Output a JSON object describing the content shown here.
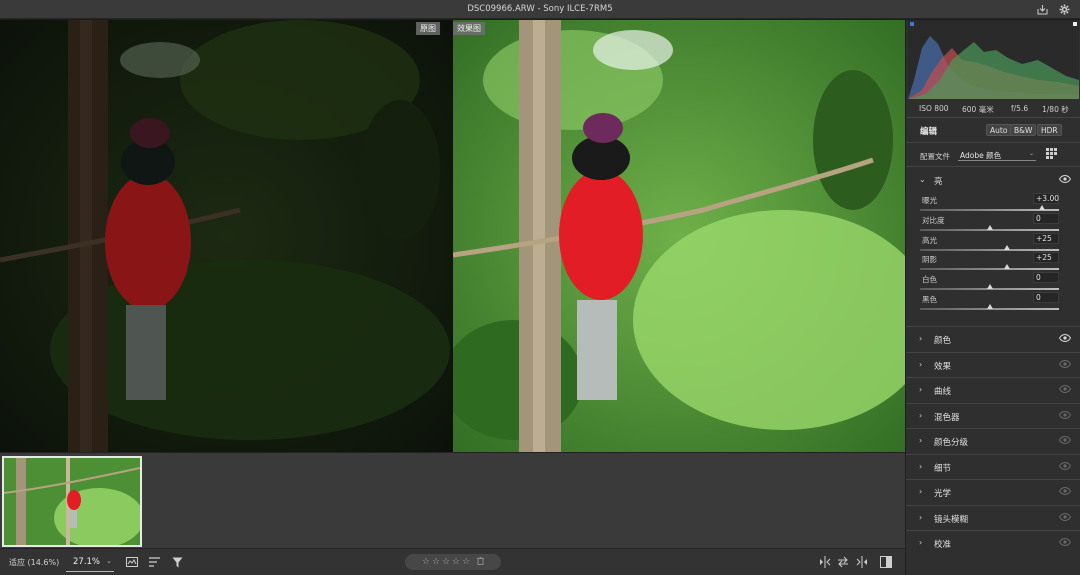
{
  "window": {
    "title": "DSC09966.ARW - Sony ILCE-7RM5"
  },
  "viewer": {
    "before_label": "原图",
    "after_label": "效果图"
  },
  "bottombar": {
    "fit_label": "适应 (14.6%)",
    "zoom_value": "27.1%",
    "stars": [
      "☆",
      "☆",
      "☆",
      "☆",
      "☆"
    ],
    "icons": [
      "compare-icon",
      "sort-icon",
      "filter-icon",
      "swap-left-icon",
      "swap-icon",
      "swap-right-icon",
      "split-view-icon"
    ]
  },
  "panel": {
    "histogram_colors": {
      "red": "#c0504d",
      "green": "#4c9a5a",
      "blue": "#4a6fb0"
    },
    "exif": {
      "iso": "ISO 800",
      "focal": "600 毫米",
      "aperture": "f/5.6",
      "shutter": "1/80 秒"
    },
    "edit_title": "编辑",
    "edit_buttons": {
      "auto": "Auto",
      "bw": "B&W",
      "hdr": "HDR"
    },
    "profile": {
      "label": "配置文件",
      "value": "Adobe 颜色"
    },
    "light": {
      "title": "亮",
      "sliders": [
        {
          "label": "曝光",
          "value": "+3.00",
          "fraction": 0.875
        },
        {
          "label": "对比度",
          "value": "0",
          "fraction": 0.5
        },
        {
          "label": "高光",
          "value": "+25",
          "fraction": 0.625
        },
        {
          "label": "阴影",
          "value": "+25",
          "fraction": 0.625
        },
        {
          "label": "白色",
          "value": "0",
          "fraction": 0.5
        },
        {
          "label": "黑色",
          "value": "0",
          "fraction": 0.5
        }
      ]
    },
    "sections": [
      {
        "label": "颜色"
      },
      {
        "label": "效果"
      },
      {
        "label": "曲线"
      },
      {
        "label": "混色器"
      },
      {
        "label": "颜色分级"
      },
      {
        "label": "细节"
      },
      {
        "label": "光学"
      },
      {
        "label": "镜头模糊"
      },
      {
        "label": "校准"
      }
    ]
  }
}
